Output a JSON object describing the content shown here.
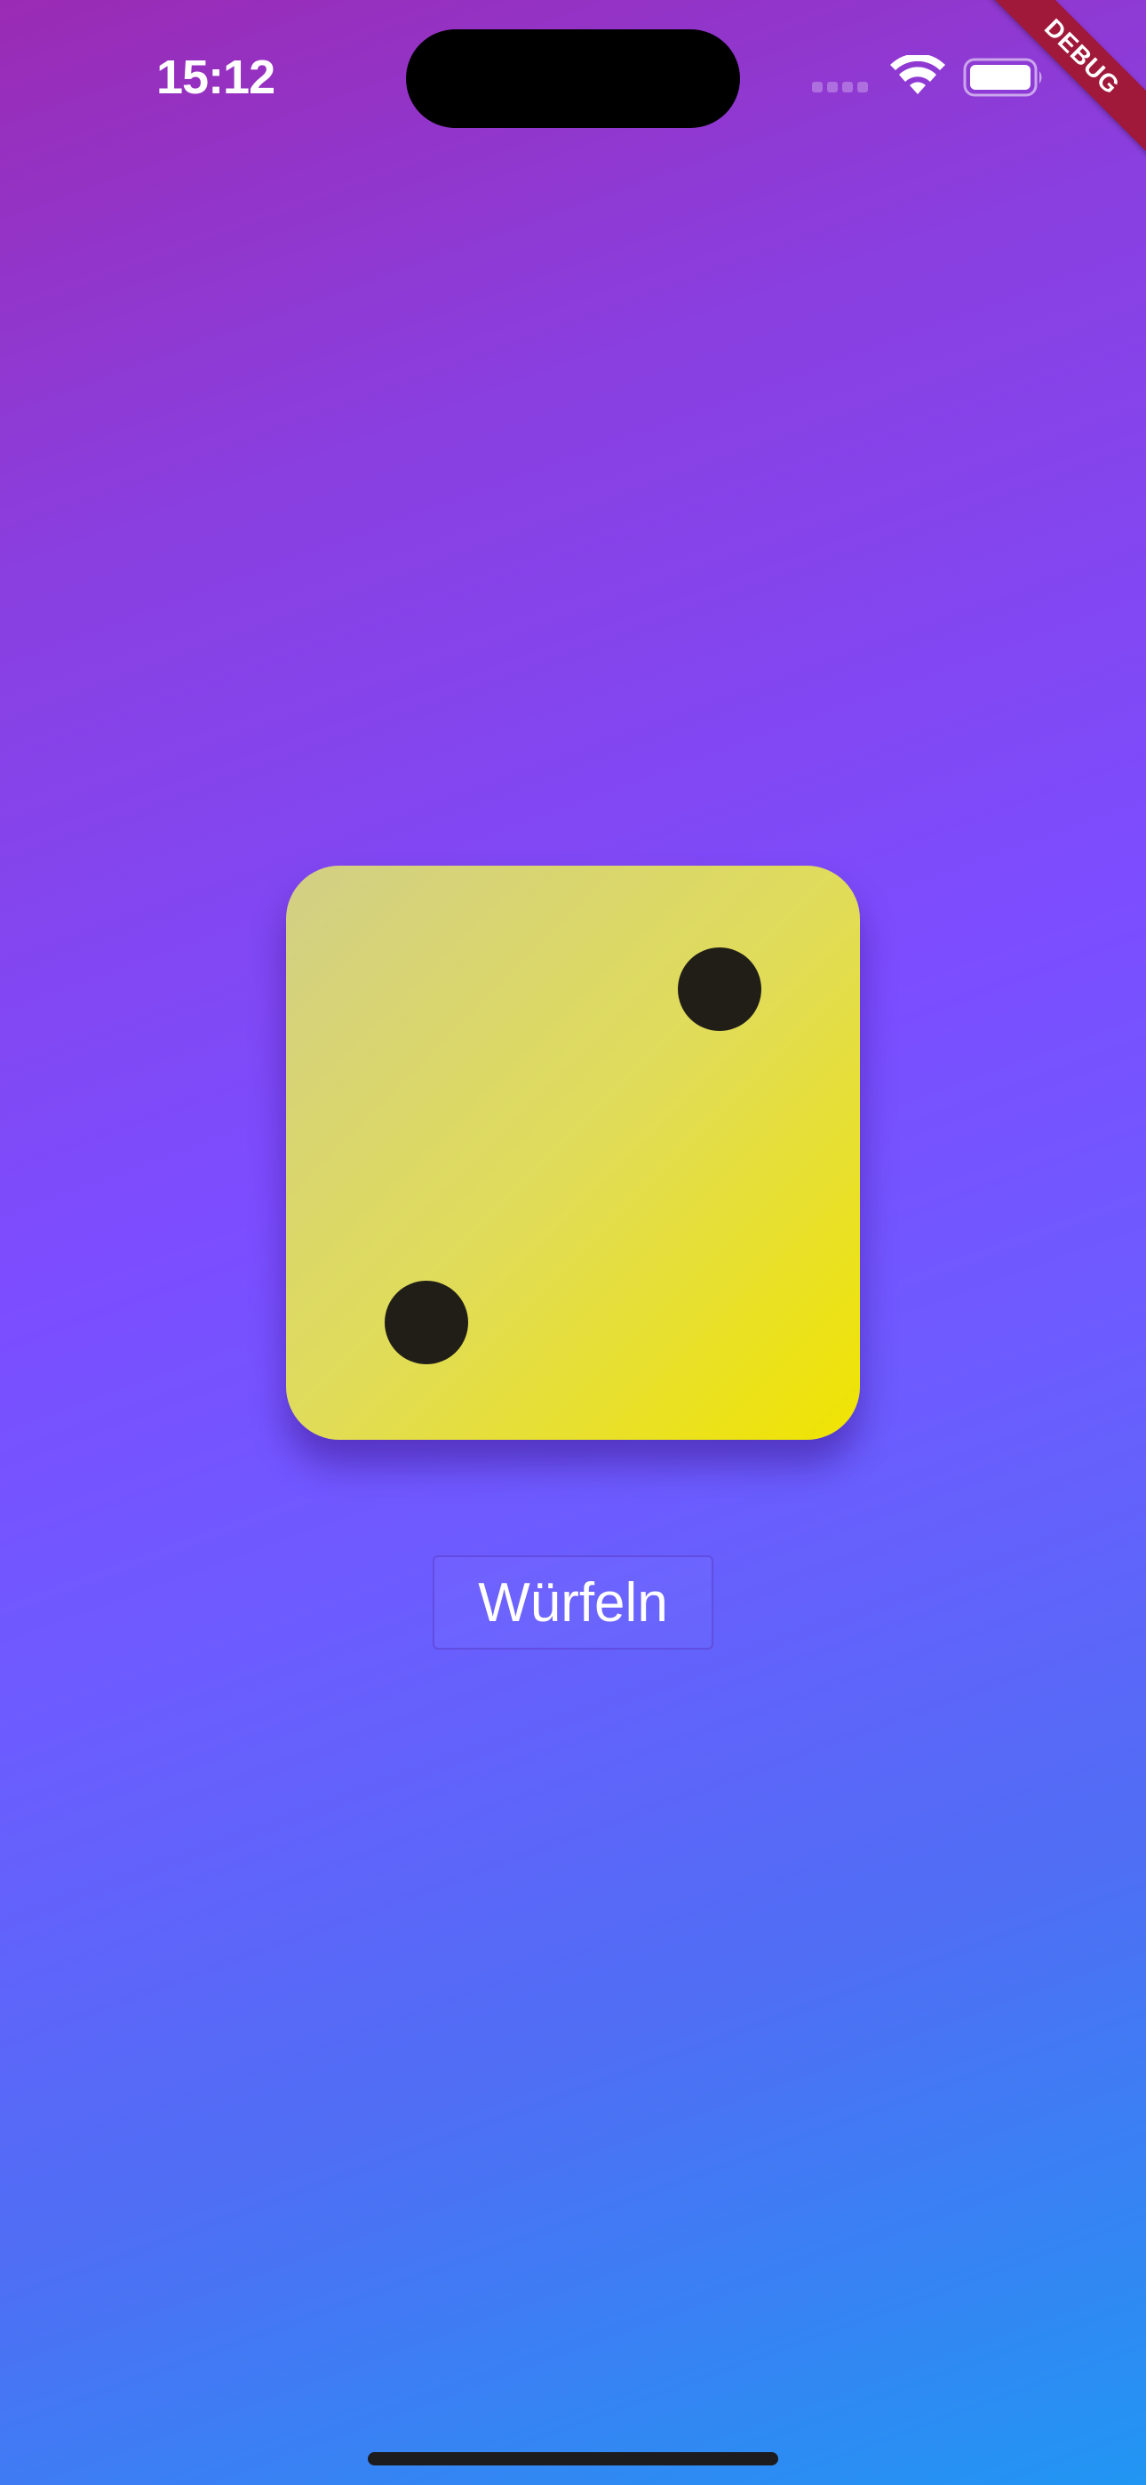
{
  "status_bar": {
    "time": "15:12",
    "icons": [
      "cellular-signal-icon",
      "wifi-icon",
      "battery-icon"
    ]
  },
  "debug_banner": {
    "label": "DEBUG",
    "color": "#a0183a"
  },
  "die": {
    "value": 2,
    "pips": [
      "top-right",
      "bottom-left"
    ],
    "colors": {
      "face_start": "#d2cf86",
      "face_end": "#f0e400",
      "pip": "#211e18"
    }
  },
  "roll_button": {
    "label": "Würfeln"
  },
  "theme": {
    "background_gradient": [
      "#9a2bb4",
      "#7c4dff",
      "#2196f3"
    ]
  }
}
